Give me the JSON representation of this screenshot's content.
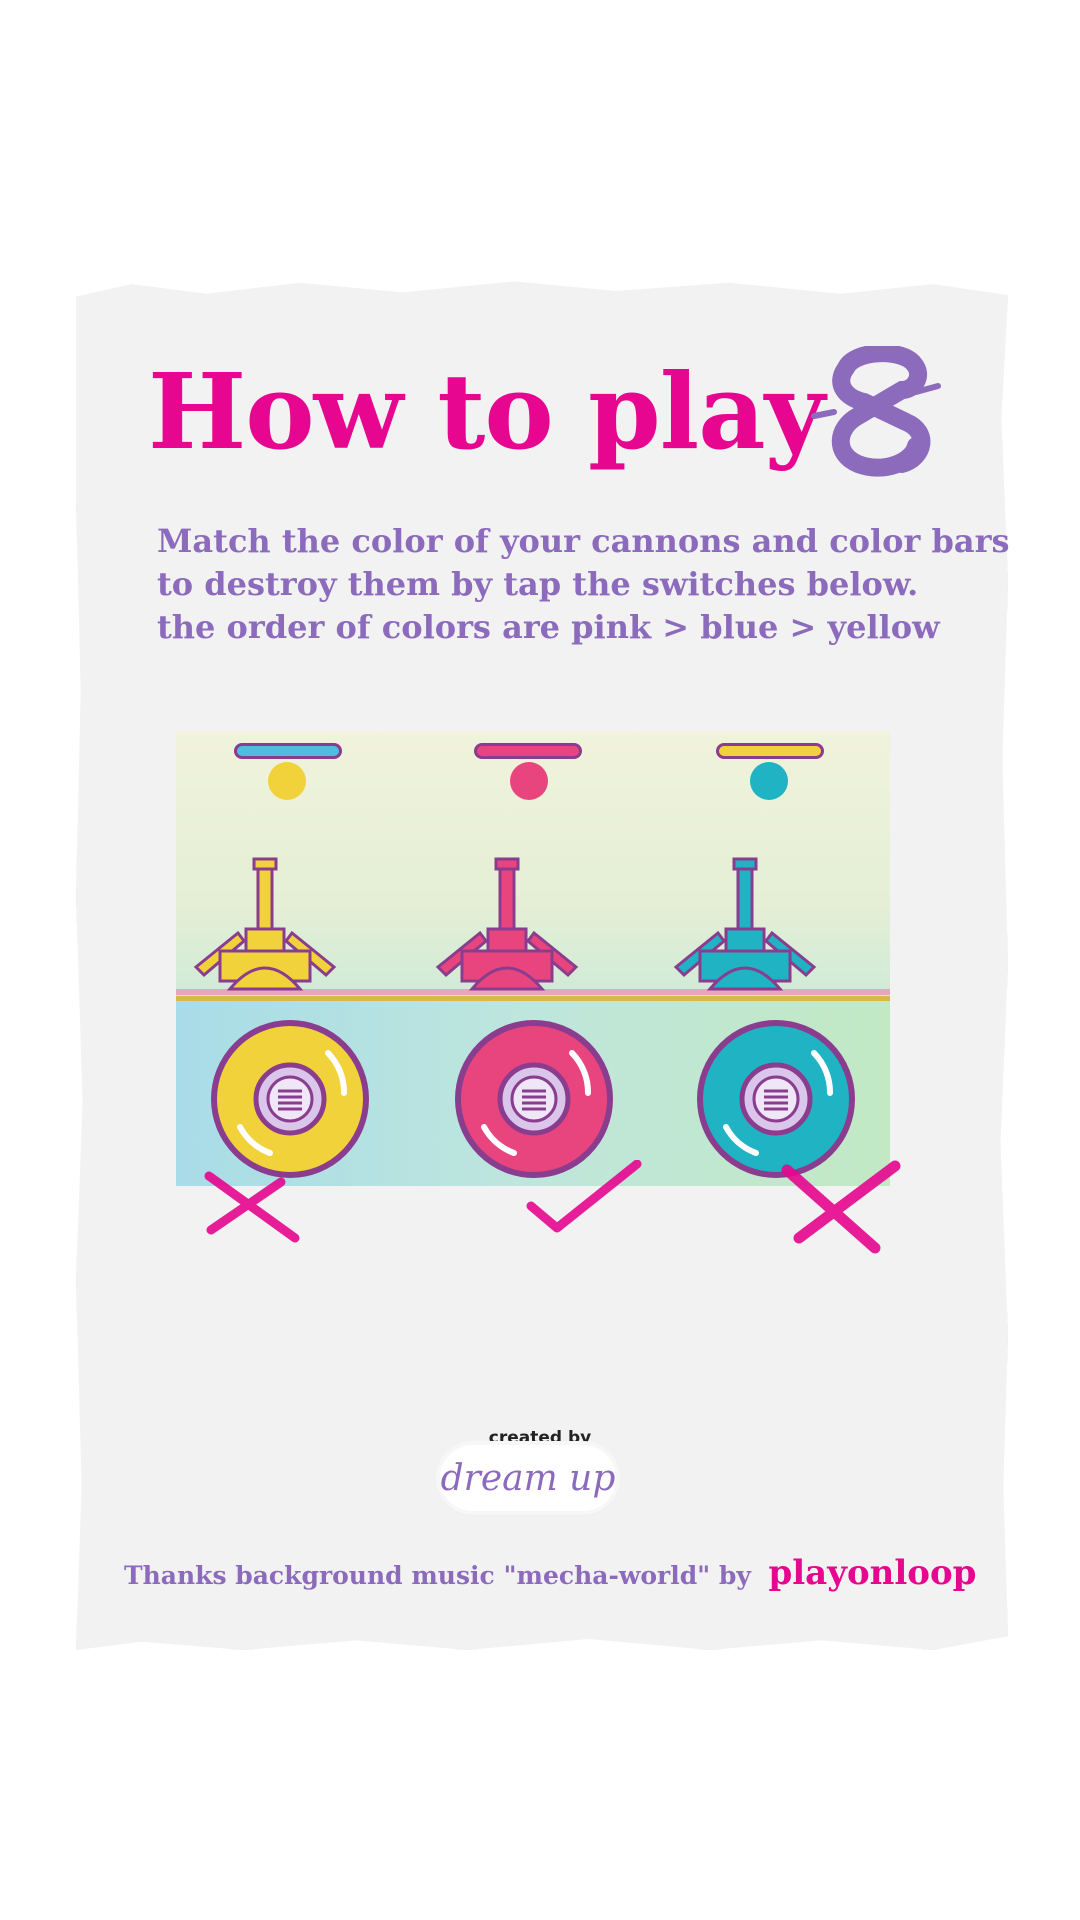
{
  "title": "How to play",
  "instructions": [
    "Match the color of your cannons and color bars",
    "to destroy them by tap the switches below.",
    "the order of colors are pink > blue > yellow"
  ],
  "colors": {
    "pink": "#e6068f",
    "purple": "#8c6bbd",
    "yellow": "#f2d23a",
    "cannon_pink": "#e8457f",
    "teal": "#1fb3c4",
    "blue_bar": "#4fbde0",
    "paper": "#f2f2f2"
  },
  "screenshot": {
    "color_bars": [
      "blue",
      "pink",
      "yellow"
    ],
    "balls": [
      "yellow",
      "pink",
      "teal"
    ],
    "cannons": [
      "yellow",
      "pink",
      "teal"
    ],
    "switches": [
      "yellow",
      "pink",
      "teal"
    ],
    "results": [
      "cross",
      "check",
      "cross"
    ]
  },
  "footer": {
    "created_by": "created by",
    "brand": "dream up",
    "thanks": "Thanks background music \"mecha-world\" by",
    "music_author": "playonloop"
  },
  "icons": [
    "logo-mark-icon",
    "cross-mark-icon",
    "check-mark-icon"
  ]
}
